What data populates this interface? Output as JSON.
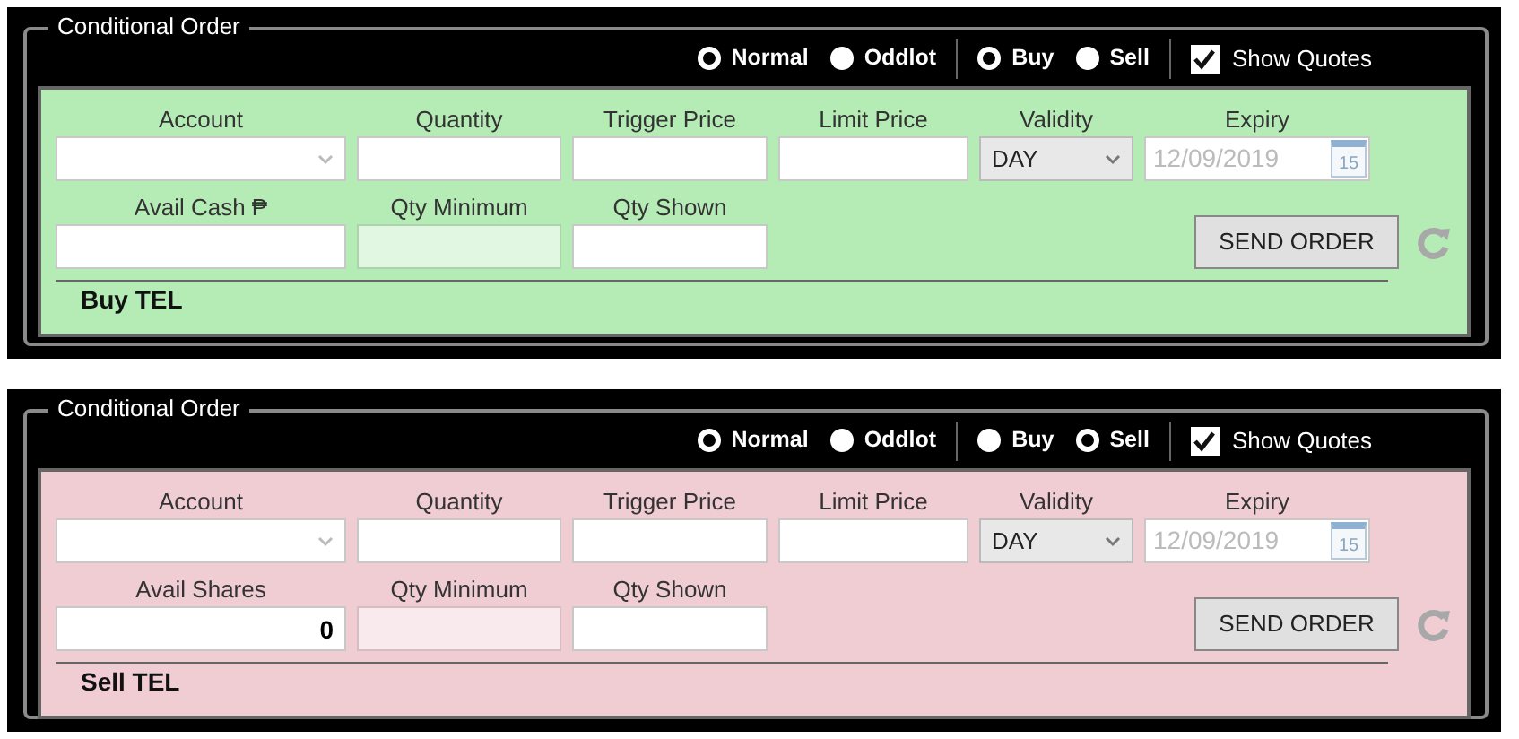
{
  "panels": [
    {
      "title": "Conditional Order",
      "color": "#b5ebb5",
      "order_types": [
        {
          "label": "Normal",
          "selected": true
        },
        {
          "label": "Oddlot",
          "selected": false
        }
      ],
      "sides": [
        {
          "label": "Buy",
          "selected": true
        },
        {
          "label": "Sell",
          "selected": false
        }
      ],
      "show_quotes": {
        "label": "Show Quotes",
        "checked": true
      },
      "fields": [
        {
          "label": "Account",
          "kind": "select",
          "disabled": false
        },
        {
          "label": "Quantity",
          "kind": "text",
          "disabled": false
        },
        {
          "label": "Trigger Price",
          "kind": "text",
          "disabled": false
        },
        {
          "label": "Limit Price",
          "kind": "text",
          "disabled": false
        },
        {
          "label": "Validity",
          "kind": "select",
          "value": "DAY",
          "disabled": false
        },
        {
          "label": "Expiry",
          "kind": "date",
          "value": "12/09/2019",
          "calendar": "15",
          "disabled": true
        }
      ],
      "fields_2": [
        {
          "label": "Avail Cash ₱",
          "kind": "text",
          "disabled": false
        },
        {
          "label": "Qty Minimum",
          "kind": "text",
          "disabled": true
        },
        {
          "label": "Qty Shown",
          "kind": "text",
          "disabled": false
        }
      ],
      "send_button": "SEND ORDER",
      "footer": "Buy TEL"
    },
    {
      "title": "Conditional Order",
      "color": "#f0ccd3",
      "order_types": [
        {
          "label": "Normal",
          "selected": true
        },
        {
          "label": "Oddlot",
          "selected": false
        }
      ],
      "sides": [
        {
          "label": "Buy",
          "selected": false
        },
        {
          "label": "Sell",
          "selected": true
        }
      ],
      "show_quotes": {
        "label": "Show Quotes",
        "checked": true
      },
      "fields": [
        {
          "label": "Account",
          "kind": "select",
          "disabled": false
        },
        {
          "label": "Quantity",
          "kind": "text",
          "disabled": false
        },
        {
          "label": "Trigger Price",
          "kind": "text",
          "disabled": false
        },
        {
          "label": "Limit Price",
          "kind": "text",
          "disabled": false
        },
        {
          "label": "Validity",
          "kind": "select",
          "value": "DAY",
          "disabled": false
        },
        {
          "label": "Expiry",
          "kind": "date",
          "value": "12/09/2019",
          "calendar": "15",
          "disabled": true
        }
      ],
      "fields_2": [
        {
          "label": "Avail Shares",
          "kind": "text",
          "value": "0",
          "disabled": false
        },
        {
          "label": "Qty Minimum",
          "kind": "text",
          "disabled": true
        },
        {
          "label": "Qty Shown",
          "kind": "text",
          "disabled": false
        }
      ],
      "send_button": "SEND ORDER",
      "footer": "Sell TEL"
    }
  ]
}
